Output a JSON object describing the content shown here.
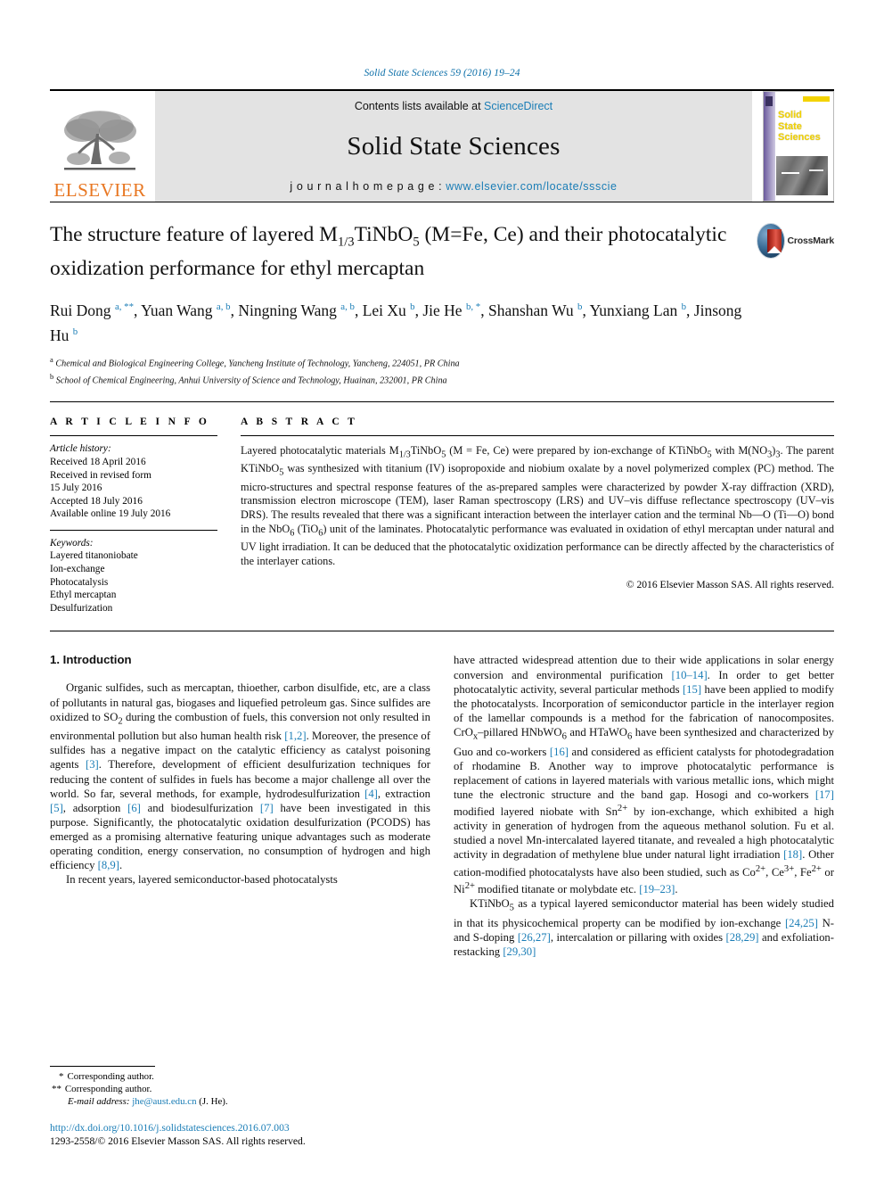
{
  "running_head": "Solid State Sciences 59 (2016) 19–24",
  "banner": {
    "publisher": "ELSEVIER",
    "contents_prefix": "Contents lists available at ",
    "contents_link": "ScienceDirect",
    "journal_name": "Solid State Sciences",
    "homepage_prefix": "j o u r n a l   h o m e p a g e :  ",
    "homepage_url": "www.elsevier.com/locate/ssscie",
    "cover_title_line1": "Solid",
    "cover_title_line2": "State",
    "cover_title_line3": "Sciences"
  },
  "crossmark": {
    "label": "CrossMark"
  },
  "article": {
    "title_part1": "The structure feature of layered M",
    "title_sub1": "1/3",
    "title_part2": "TiNbO",
    "title_sub2": "5",
    "title_part3": " (M=Fe, Ce) and their photocatalytic oxidization performance for ethyl mercaptan",
    "authors": "Rui Dong a, **, Yuan Wang a, b, Ningning Wang a, b, Lei Xu b, Jie He b, *, Shanshan Wu b, Yunxiang Lan b, Jinsong Hu b",
    "affiliation_a": "Chemical and Biological Engineering College, Yancheng Institute of Technology, Yancheng, 224051, PR China",
    "affiliation_b": "School of Chemical Engineering, Anhui University of Science and Technology, Huainan, 232001, PR China"
  },
  "article_info": {
    "heading": "A R T I C L E   I N F O",
    "history_label": "Article history:",
    "history": [
      "Received 18 April 2016",
      "Received in revised form",
      "15 July 2016",
      "Accepted 18 July 2016",
      "Available online 19 July 2016"
    ],
    "keywords_label": "Keywords:",
    "keywords": [
      "Layered titanoniobate",
      "Ion-exchange",
      "Photocatalysis",
      "Ethyl mercaptan",
      "Desulfurization"
    ]
  },
  "abstract": {
    "heading": "A B S T R A C T",
    "text": "Layered photocatalytic materials M1/3TiNbO5 (M = Fe, Ce) were prepared by ion-exchange of KTiNbO5 with M(NO3)3. The parent KTiNbO5 was synthesized with titanium (IV) isopropoxide and niobium oxalate by a novel polymerized complex (PC) method. The micro-structures and spectral response features of the as-prepared samples were characterized by powder X-ray diffraction (XRD), transmission electron microscope (TEM), laser Raman spectroscopy (LRS) and UV–vis diffuse reflectance spectroscopy (UV–vis DRS). The results revealed that there was a significant interaction between the interlayer cation and the terminal Nb—O (Ti—O) bond in the NbO6 (TiO6) unit of the laminates. Photocatalytic performance was evaluated in oxidation of ethyl mercaptan under natural and UV light irradiation. It can be deduced that the photocatalytic oxidization performance can be directly affected by the characteristics of the interlayer cations.",
    "copyright": "© 2016 Elsevier Masson SAS. All rights reserved."
  },
  "introduction": {
    "heading": "1.  Introduction",
    "left_p1": "Organic sulfides, such as mercaptan, thioether, carbon disulfide, etc, are a class of pollutants in natural gas, biogases and liquefied petroleum gas. Since sulfides are oxidized to SO2 during the combustion of fuels, this conversion not only resulted in environmental pollution but also human health risk [1,2]. Moreover, the presence of sulfides has a negative impact on the catalytic efficiency as catalyst poisoning agents [3]. Therefore, development of efficient desulfurization techniques for reducing the content of sulfides in fuels has become a major challenge all over the world. So far, several methods, for example, hydrodesulfurization [4], extraction [5], adsorption [6] and biodesulfurization [7] have been investigated in this purpose. Significantly, the photocatalytic oxidation desulfurization (PCODS) has emerged as a promising alternative featuring unique advantages such as moderate operating condition, energy conservation, no consumption of hydrogen and high efficiency [8,9].",
    "left_p2": "In recent years, layered semiconductor-based photocatalysts",
    "right_p1": "have attracted widespread attention due to their wide applications in solar energy conversion and environmental purification [10–14]. In order to get better photocatalytic activity, several particular methods [15] have been applied to modify the photocatalysts. Incorporation of semiconductor particle in the interlayer region of the lamellar compounds is a method for the fabrication of nanocomposites. CrOx–pillared HNbWO6 and HTaWO6 have been synthesized and characterized by Guo and co-workers [16] and considered as efficient catalysts for photodegradation of rhodamine B. Another way to improve photocatalytic performance is replacement of cations in layered materials with various metallic ions, which might tune the electronic structure and the band gap. Hosogi and co-workers [17] modified layered niobate with Sn2+ by ion-exchange, which exhibited a high activity in generation of hydrogen from the aqueous methanol solution. Fu et al. studied a novel Mn-intercalated layered titanate, and revealed a high photocatalytic activity in degradation of methylene blue under natural light irradiation [18]. Other cation-modified photocatalysts have also been studied, such as Co2+, Ce3+, Fe2+ or Ni2+ modified titanate or molybdate etc. [19–23].",
    "right_p2": "KTiNbO5 as a typical layered semiconductor material has been widely studied in that its physicochemical property can be modified by ion-exchange [24,25] N- and S-doping [26,27], intercalation or pillaring with oxides [28,29] and exfoliation-restacking [29,30]"
  },
  "footnotes": {
    "corresponding_1": "Corresponding author.",
    "corresponding_2": "Corresponding author.",
    "email_label": "E-mail address:",
    "email": "jhe@aust.edu.cn",
    "email_suffix": "(J. He).",
    "doi": "http://dx.doi.org/10.1016/j.solidstatesciences.2016.07.003",
    "issn": "1293-2558/© 2016 Elsevier Masson SAS. All rights reserved."
  },
  "colors": {
    "link": "#1a7db6",
    "elsevier_orange": "#E87722",
    "banner_gray": "#e3e3e3",
    "cover_yellow": "#f3d300"
  }
}
